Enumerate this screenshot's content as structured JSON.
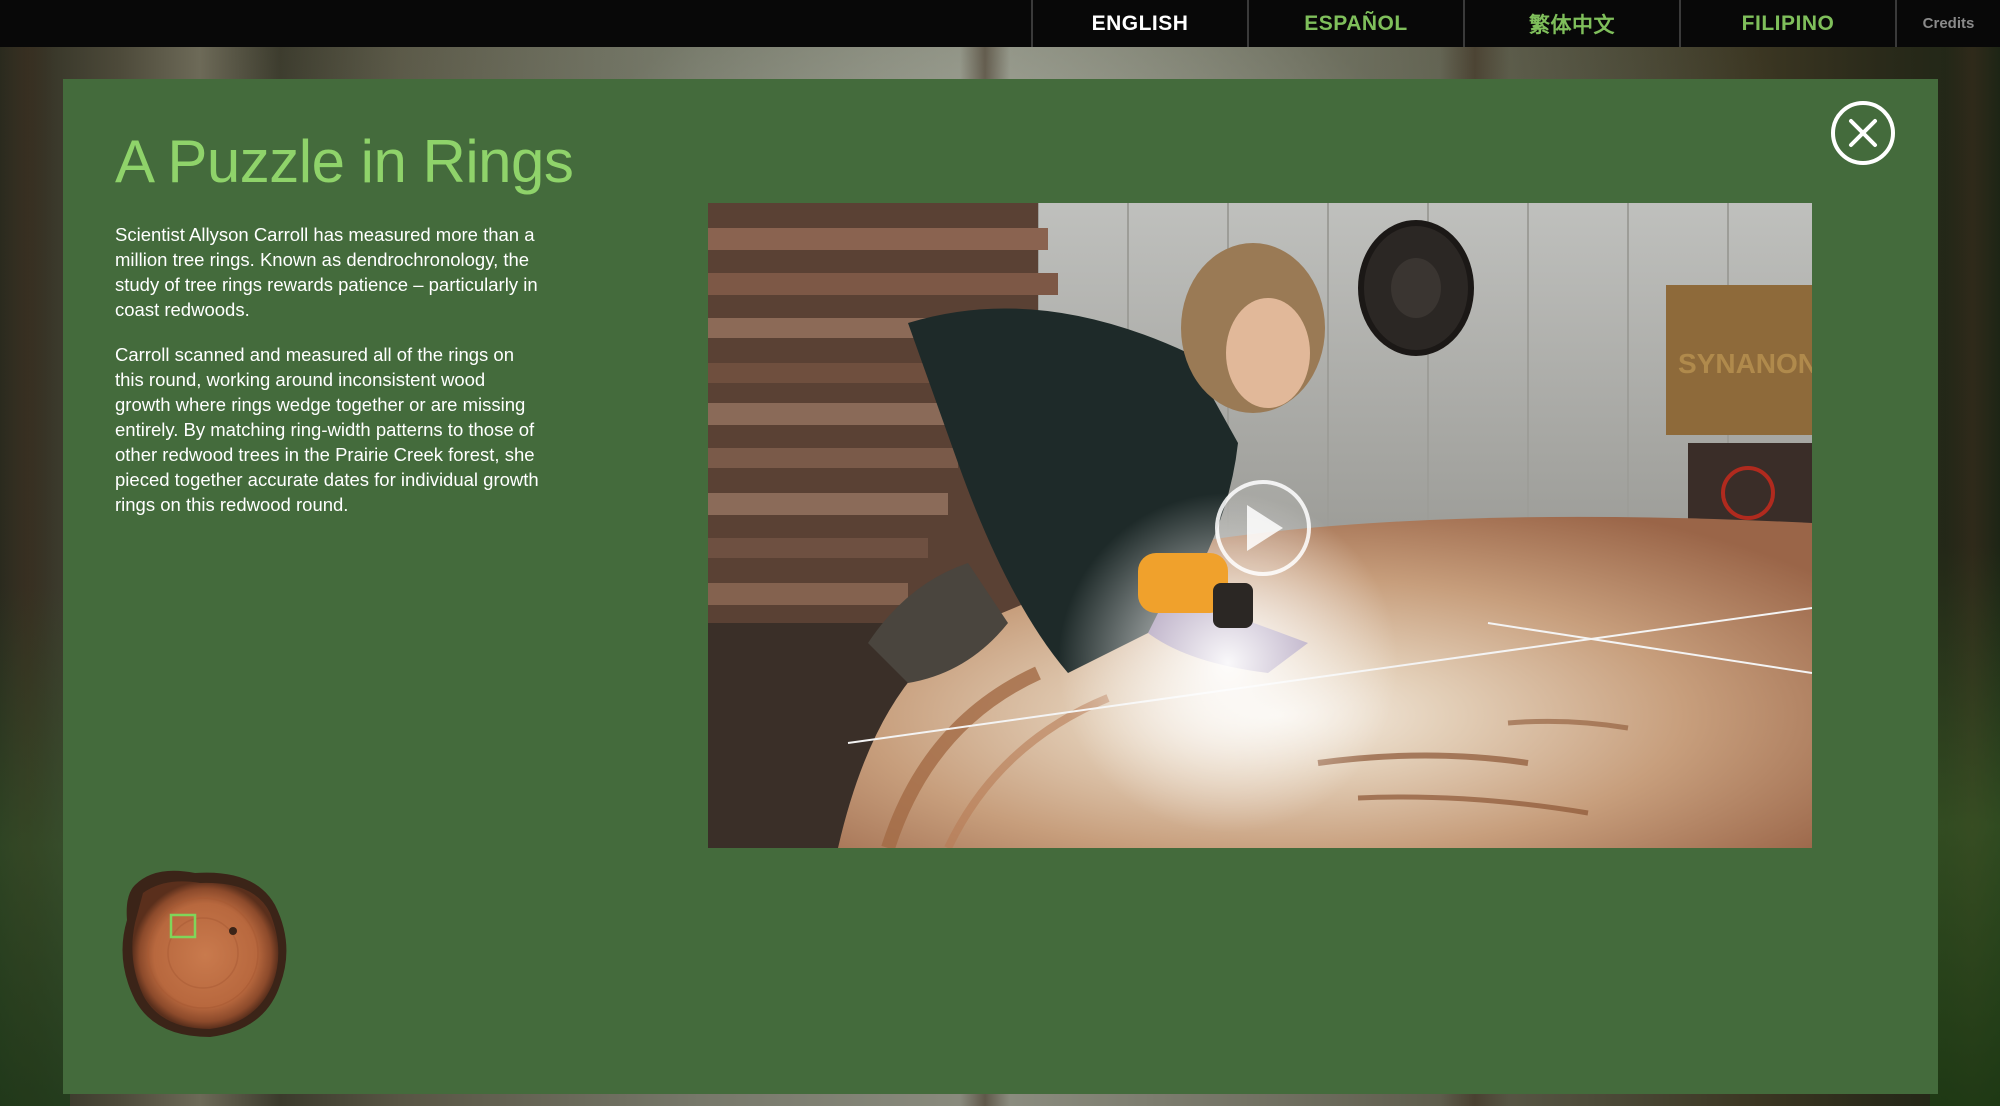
{
  "nav": {
    "languages": [
      {
        "label": "ENGLISH",
        "active": true
      },
      {
        "label": "ESPAÑOL",
        "active": false
      },
      {
        "label": "繁体中文",
        "active": false
      },
      {
        "label": "FILIPINO",
        "active": false
      }
    ],
    "credits_label": "Credits"
  },
  "modal": {
    "title": "A Puzzle in Rings",
    "paragraphs": [
      "Scientist Allyson Carroll has measured more than a million tree rings. Known as dendrochronology, the study of tree rings rewards patience – particularly in coast redwoods.",
      "Carroll scanned and measured all of the rings on this round, working around inconsistent wood growth where rings wedge together or are missing entirely. By matching ring-width patterns to those of other redwood trees in the Prairie Creek forest, she pieced together accurate dates for individual growth rings on this redwood round."
    ],
    "close_icon": "close-icon",
    "video": {
      "play_icon": "play-icon",
      "sign_text": "SYNANON"
    }
  },
  "colors": {
    "modal_bg": "#446b3c",
    "title_green": "#8fd36a",
    "tab_green": "#7fbf5b",
    "topbar_bg": "#080808"
  }
}
